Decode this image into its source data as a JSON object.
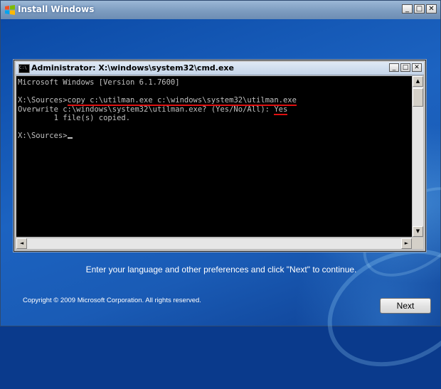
{
  "outer_window": {
    "title": "Install Windows",
    "controls": {
      "minimize": "_",
      "maximize": "□",
      "close": "✕"
    }
  },
  "cmd_window": {
    "title": "Administrator: X:\\windows\\system32\\cmd.exe",
    "icon_label": "C:\\",
    "controls": {
      "minimize": "_",
      "maximize": "□",
      "close": "✕"
    },
    "console": {
      "line1": "Microsoft Windows [Version 6.1.7600]",
      "prompt1": "X:\\Sources>",
      "command": "copy c:\\utilman.exe c:\\windows\\system32\\utilman.exe",
      "overwrite_question": "Overwrite c:\\windows\\system32\\utilman.exe? (Yes/No/All): ",
      "overwrite_answer": "Yes",
      "copied": "        1 file(s) copied.",
      "prompt2": "X:\\Sources>"
    },
    "scroll": {
      "up": "▲",
      "down": "▼",
      "left": "◄",
      "right": "►"
    },
    "highlight_color": "#e01010"
  },
  "footer": {
    "instruction": "Enter your language and other preferences and click \"Next\" to continue.",
    "copyright": "Copyright © 2009 Microsoft Corporation. All rights reserved.",
    "next_label": "Next"
  }
}
